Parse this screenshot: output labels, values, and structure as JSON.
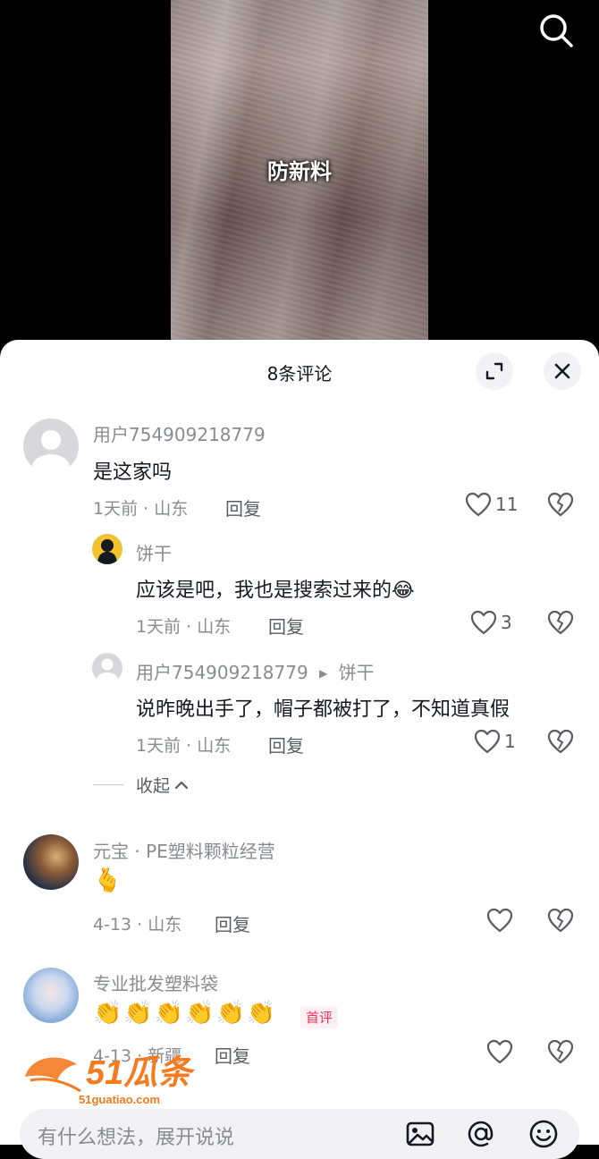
{
  "video": {
    "caption": "防新料"
  },
  "comments_panel": {
    "title": "8条评论",
    "comments": [
      {
        "user": "用户754909218779",
        "text": "是这家吗",
        "meta": "1天前 · 山东",
        "reply_label": "回复",
        "likes": "11",
        "replies": [
          {
            "user": "饼干",
            "text": "应该是吧，我也是搜索过来的",
            "emoji": "😂",
            "meta": "1天前 · 山东",
            "reply_label": "回复",
            "likes": "3"
          },
          {
            "user": "用户754909218779",
            "reply_to": "饼干",
            "text": "说昨晚出手了，帽子都被打了，不知道真假",
            "meta": "1天前 · 山东",
            "reply_label": "回复",
            "likes": "1"
          }
        ],
        "collapse_label": "收起"
      },
      {
        "user": "元宝 · PE塑料颗粒经营",
        "text": "🫰",
        "meta": "4-13 · 山东",
        "reply_label": "回复",
        "likes": ""
      },
      {
        "user": "专业批发塑料袋",
        "text": "👏👏👏👏👏👏",
        "badge": "首评",
        "meta": "4-13 · 新疆",
        "reply_label": "回复",
        "likes": ""
      }
    ]
  },
  "watermark": {
    "brand": "51瓜条",
    "domain": "51guatiao.com"
  },
  "input": {
    "placeholder": "有什么想法，展开说说"
  },
  "colors": {
    "accent": "#fe2c55",
    "text": "#161823",
    "secondary": "#8a8b91",
    "watermark": "#f47b20"
  }
}
